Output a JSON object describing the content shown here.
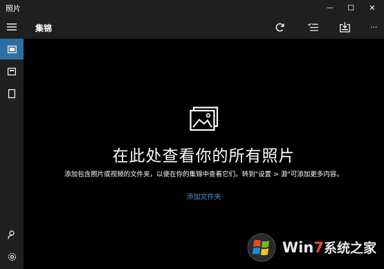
{
  "window": {
    "title": "照片",
    "minimize_glyph": "—",
    "maximize_glyph": "☐",
    "close_glyph": "✕"
  },
  "appbar": {
    "title": "集锦",
    "more_glyph": "···"
  },
  "rail": {
    "items": [
      {
        "icon": "hamburger-icon"
      },
      {
        "icon": "collection-icon",
        "active": true
      },
      {
        "icon": "album-icon"
      },
      {
        "icon": "folder-icon"
      },
      {
        "icon": "person-icon"
      },
      {
        "icon": "gear-icon"
      }
    ]
  },
  "toolbar": {
    "items": [
      {
        "icon": "refresh-icon"
      },
      {
        "icon": "select-icon"
      },
      {
        "icon": "import-icon"
      },
      {
        "icon": "more-icon"
      }
    ]
  },
  "empty_state": {
    "icon": "photos-icon",
    "title": "在此处查看你的所有照片",
    "description": "添加包含照片或视频的文件夹，以便在你的集锦中查看它们。转到\"设置 > 源\"可添加更多内容。",
    "link": "添加文件夹"
  },
  "watermark": {
    "text_win": "Win",
    "text_7": "7",
    "text_rest": "系统之家"
  },
  "colors": {
    "accent": "#2f6ea3",
    "link": "#4a8fd6",
    "chrome": "#1f1f1f",
    "background": "#000000"
  }
}
